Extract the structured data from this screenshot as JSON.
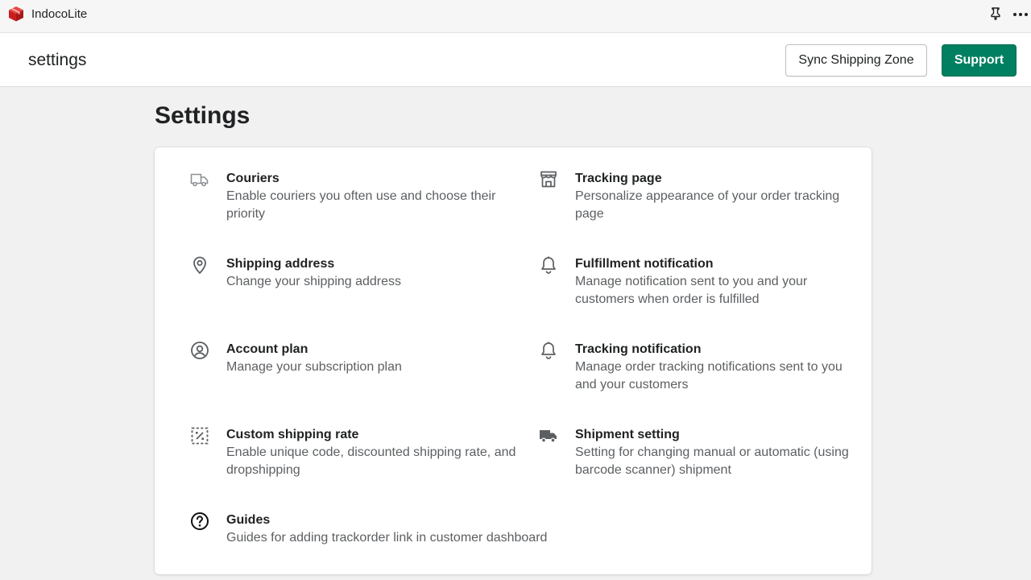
{
  "app": {
    "name": "IndocoLite"
  },
  "header": {
    "crumb": "settings",
    "sync_label": "Sync Shipping Zone",
    "support_label": "Support"
  },
  "page": {
    "title": "Settings"
  },
  "settings": {
    "couriers": {
      "title": "Couriers",
      "desc": "Enable couriers you often use and choose their priority",
      "icon": "truck-outline-icon"
    },
    "tracking_page": {
      "title": "Tracking page",
      "desc": "Personalize appearance of your order tracking page",
      "icon": "storefront-icon"
    },
    "shipping_address": {
      "title": "Shipping address",
      "desc": "Change your shipping address",
      "icon": "location-pin-icon"
    },
    "fulfillment_notification": {
      "title": "Fulfillment notification",
      "desc": "Manage notification sent to you and your customers when order is fulfilled",
      "icon": "bell-icon"
    },
    "account_plan": {
      "title": "Account plan",
      "desc": "Manage your subscription plan",
      "icon": "user-circle-icon"
    },
    "tracking_notification": {
      "title": "Tracking notification",
      "desc": "Manage order tracking notifications sent to you and your customers",
      "icon": "bell-icon"
    },
    "custom_shipping_rate": {
      "title": "Custom shipping rate",
      "desc": "Enable unique code, discounted shipping rate, and dropshipping",
      "icon": "discount-icon"
    },
    "shipment_setting": {
      "title": "Shipment setting",
      "desc": "Setting for changing manual or automatic (using barcode scanner) shipment",
      "icon": "truck-filled-icon"
    },
    "guides": {
      "title": "Guides",
      "desc": "Guides for adding trackorder link in customer dashboard",
      "icon": "question-circle-icon"
    }
  },
  "colors": {
    "primary": "#008060",
    "logo": "#d82c2c",
    "icon": "#5c5f62"
  }
}
